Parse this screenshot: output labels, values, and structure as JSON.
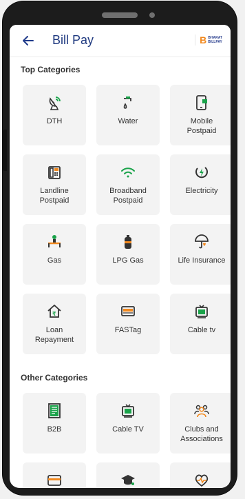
{
  "header": {
    "title": "Bill Pay",
    "logo_b": "B",
    "logo_line1": "BHARAT",
    "logo_line2": "BILLPAY"
  },
  "sections": {
    "top": "Top Categories",
    "other": "Other Categories"
  },
  "top_categories": [
    {
      "label": "DTH",
      "icon": "satellite-dish-icon"
    },
    {
      "label": "Water",
      "icon": "water-tap-icon"
    },
    {
      "label": "Mobile\nPostpaid",
      "icon": "mobile-phone-icon"
    },
    {
      "label": "Landline\nPostpaid",
      "icon": "landline-phone-icon"
    },
    {
      "label": "Broadband\nPostpaid",
      "icon": "wifi-icon"
    },
    {
      "label": "Electricity",
      "icon": "electricity-bolt-icon"
    },
    {
      "label": "Gas",
      "icon": "gas-pipe-icon"
    },
    {
      "label": "LPG Gas",
      "icon": "gas-cylinder-icon"
    },
    {
      "label": "Life Insurance",
      "icon": "umbrella-heart-icon"
    },
    {
      "label": "Loan\nRepayment",
      "icon": "house-rupee-icon"
    },
    {
      "label": "FASTag",
      "icon": "fastag-card-icon"
    },
    {
      "label": "Cable tv",
      "icon": "television-icon"
    }
  ],
  "other_categories": [
    {
      "label": "B2B",
      "icon": "invoice-document-icon"
    },
    {
      "label": "Cable TV",
      "icon": "television-icon"
    },
    {
      "label": "Clubs and\nAssociations",
      "icon": "people-group-icon"
    },
    {
      "label": "",
      "icon": "credit-card-icon"
    },
    {
      "label": "",
      "icon": "graduation-cap-icon"
    },
    {
      "label": "",
      "icon": "heartbeat-icon"
    }
  ],
  "colors": {
    "accent": "#1f3a8a",
    "icon_orange": "#f2891f",
    "icon_green": "#1aa34a",
    "title": "#203a80"
  }
}
